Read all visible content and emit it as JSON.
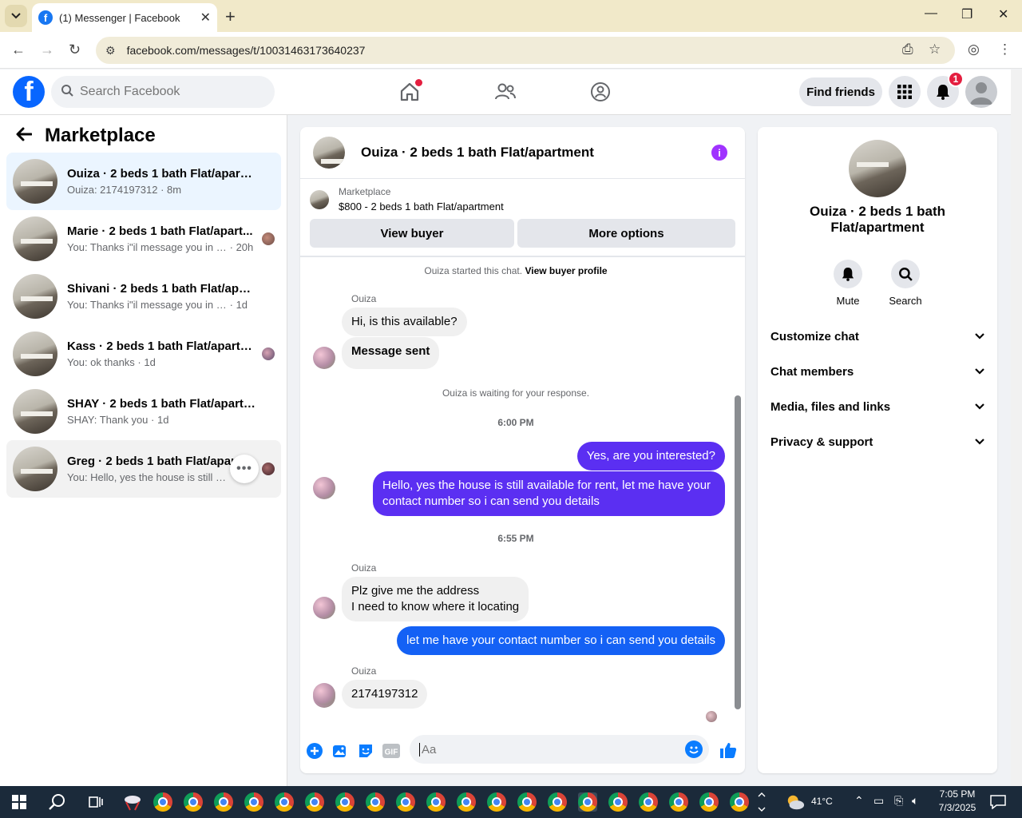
{
  "browser": {
    "tab_title": "(1) Messenger | Facebook",
    "url": "facebook.com/messages/t/10031463173640237"
  },
  "fb_header": {
    "search_placeholder": "Search Facebook",
    "find_friends_label": "Find friends",
    "notification_count": "1"
  },
  "sidebar": {
    "title": "Marketplace",
    "conversations": [
      {
        "name": "Ouiza · 2 beds 1 bath Flat/apartment",
        "snippet": "Ouiza: 2174197312",
        "time": "8m"
      },
      {
        "name": "Marie · 2 beds 1 bath Flat/apart...",
        "snippet": "You: Thanks i\"il message you in a ...",
        "time": "20h"
      },
      {
        "name": "Shivani · 2 beds 1 bath Flat/apartm...",
        "snippet": "You: Thanks i\"il message you in a mo...",
        "time": "1d"
      },
      {
        "name": "Kass · 2 beds 1 bath Flat/apartm...",
        "snippet": "You: ok thanks",
        "time": "1d"
      },
      {
        "name": "SHAY · 2 beds 1 bath Flat/apartment",
        "snippet": "SHAY: Thank you",
        "time": "1d"
      },
      {
        "name": "Greg · 2 beds 1 bath Flat/apart",
        "snippet": "You: Hello, yes the house is still ava...",
        "time": ""
      }
    ]
  },
  "chat": {
    "title": "Ouiza · 2 beds 1 bath Flat/apartment",
    "marketplace_label": "Marketplace",
    "listing": "$800 - 2 beds 1 bath Flat/apartment",
    "view_buyer_label": "View buyer",
    "more_options_label": "More options",
    "started_text": "Ouiza started this chat.",
    "view_profile_link": "View buyer profile",
    "sender_name": "Ouiza",
    "msg1": "Hi, is this available?",
    "msg2": "Message sent",
    "waiting_text": "Ouiza is waiting for your response.",
    "time1": "6:00 PM",
    "out1": "Yes, are you interested?",
    "out2_line1": "Hello, yes the house is still available for rent, let me have your",
    "out2_line2": "contact number so i can send you details",
    "time2": "6:55 PM",
    "msg3_line1": "Plz give me the address",
    "msg3_line2": "I need to know where it locating",
    "out3": "let me have your contact number so i can send you details",
    "msg4": "2174197312",
    "composer_placeholder": "Aa"
  },
  "details": {
    "name": "Ouiza · 2 beds 1 bath Flat/apartment",
    "mute_label": "Mute",
    "search_label": "Search",
    "rows": [
      "Customize chat",
      "Chat members",
      "Media, files and links",
      "Privacy & support"
    ]
  },
  "taskbar": {
    "temperature": "41°C",
    "time": "7:05 PM",
    "date": "7/3/2025"
  },
  "colors": {
    "fb_blue": "#0866ff",
    "outgoing_purple": "#5b2ff2",
    "outgoing_blue": "#1461f5",
    "active_conv": "#ebf5ff"
  }
}
